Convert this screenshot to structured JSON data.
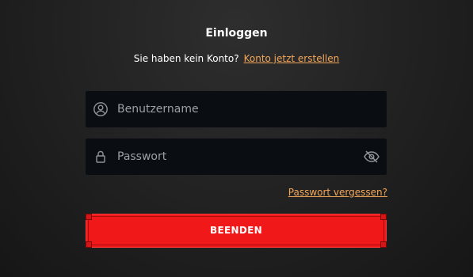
{
  "login": {
    "title": "Einloggen",
    "no_account_text": "Sie haben kein Konto?",
    "create_account_link": "Konto jetzt erstellen",
    "username": {
      "placeholder": "Benutzername",
      "value": "",
      "icon": "user-icon"
    },
    "password": {
      "placeholder": "Passwort",
      "value": "",
      "icon": "lock-icon",
      "toggle_icon": "eye-slash-icon"
    },
    "forgot_password_link": "Passwort vergessen?",
    "submit_label": "BEENDEN"
  },
  "colors": {
    "background": "#232323",
    "field_background": "#0a0e12",
    "link": "#f2a65a",
    "button": "#f01818",
    "text": "#ffffff",
    "placeholder": "#9aa0a6"
  }
}
